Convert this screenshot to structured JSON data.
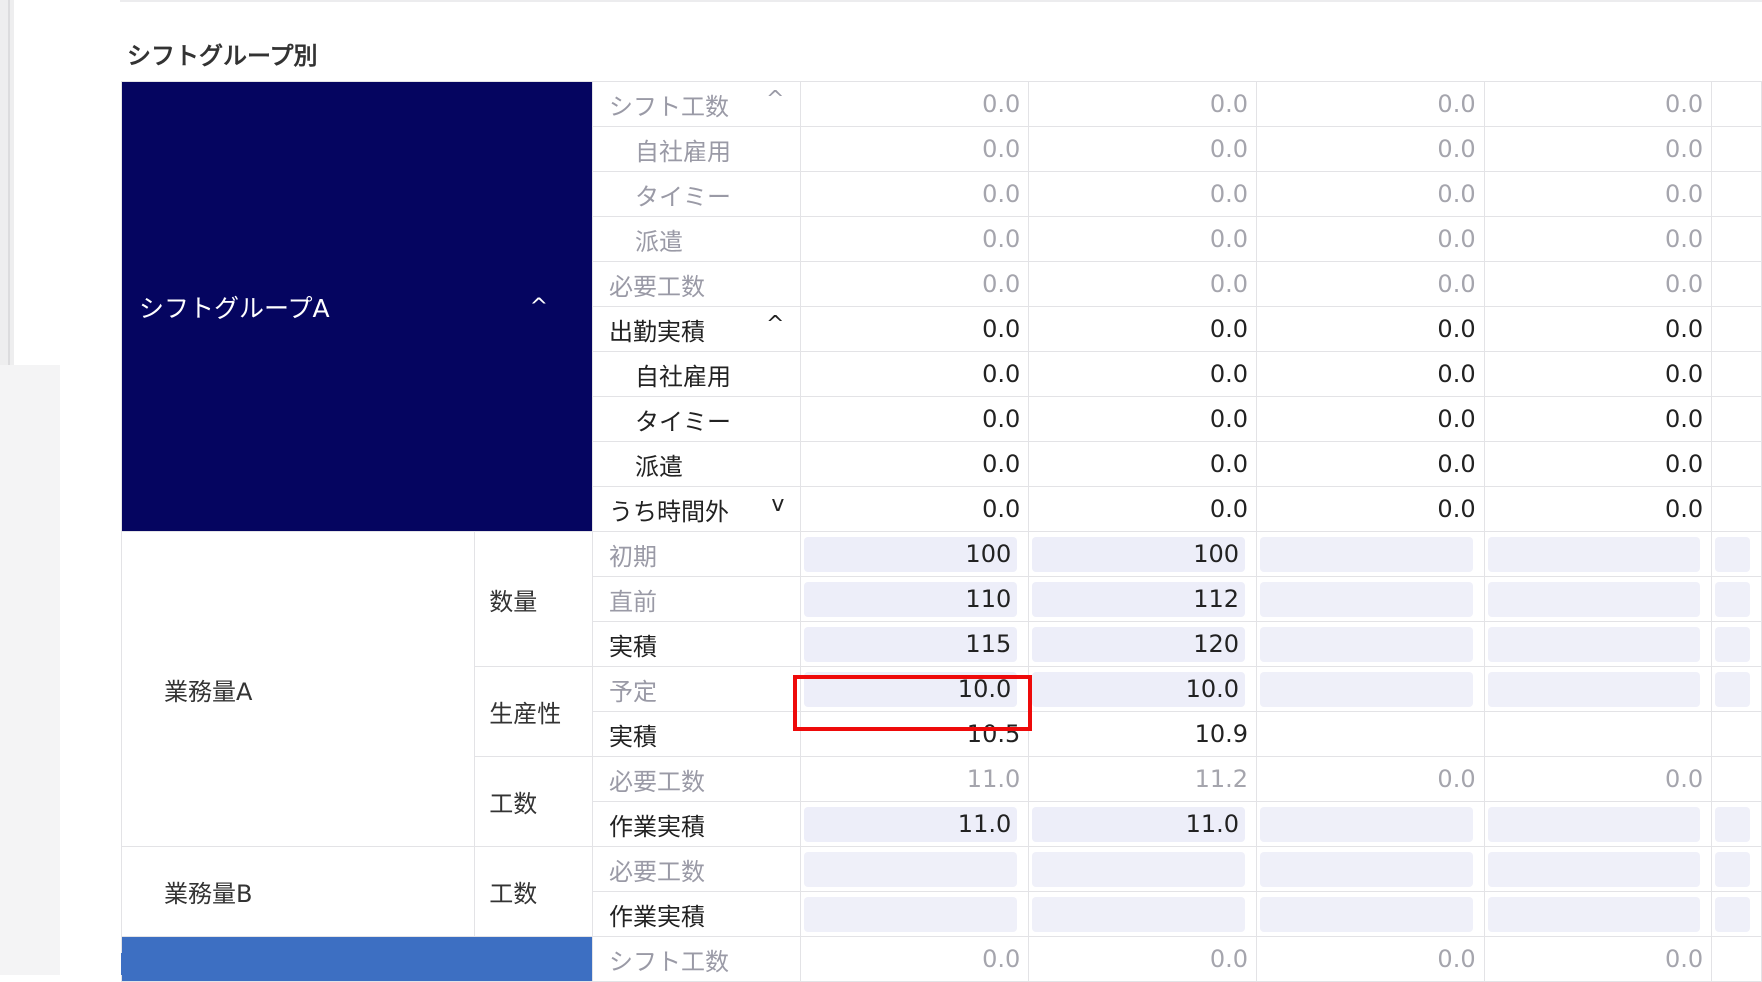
{
  "section": {
    "title": "シフトグループ別"
  },
  "group_a": {
    "name": "シフトグループA",
    "chevron": "^"
  },
  "rows": [
    {
      "label": "シフト工数",
      "chev": "^",
      "style": "gray",
      "indent": false,
      "values": [
        "0.0",
        "0.0",
        "0.0",
        "0.0"
      ]
    },
    {
      "label": "自社雇用",
      "chev": "",
      "style": "gray",
      "indent": true,
      "values": [
        "0.0",
        "0.0",
        "0.0",
        "0.0"
      ]
    },
    {
      "label": "タイミー",
      "chev": "",
      "style": "gray",
      "indent": true,
      "values": [
        "0.0",
        "0.0",
        "0.0",
        "0.0"
      ]
    },
    {
      "label": "派遣",
      "chev": "",
      "style": "gray",
      "indent": true,
      "values": [
        "0.0",
        "0.0",
        "0.0",
        "0.0"
      ]
    },
    {
      "label": "必要工数",
      "chev": "",
      "style": "gray",
      "indent": false,
      "values": [
        "0.0",
        "0.0",
        "0.0",
        "0.0"
      ]
    },
    {
      "label": "出勤実積",
      "chev": "^",
      "style": "dark",
      "indent": false,
      "values": [
        "0.0",
        "0.0",
        "0.0",
        "0.0"
      ]
    },
    {
      "label": "自社雇用",
      "chev": "",
      "style": "dark",
      "indent": true,
      "values": [
        "0.0",
        "0.0",
        "0.0",
        "0.0"
      ]
    },
    {
      "label": "タイミー",
      "chev": "",
      "style": "dark",
      "indent": true,
      "values": [
        "0.0",
        "0.0",
        "0.0",
        "0.0"
      ]
    },
    {
      "label": "派遣",
      "chev": "",
      "style": "dark",
      "indent": true,
      "values": [
        "0.0",
        "0.0",
        "0.0",
        "0.0"
      ]
    },
    {
      "label": "うち時間外",
      "chev": "v",
      "style": "dark",
      "indent": false,
      "values": [
        "0.0",
        "0.0",
        "0.0",
        "0.0"
      ]
    }
  ],
  "work_a": {
    "name": "業務量A",
    "qty_label": "数量",
    "prod_label": "生産性",
    "manhour_label": "工数",
    "rows": {
      "initial": {
        "label": "初期",
        "values": [
          "100",
          "100",
          "",
          ""
        ]
      },
      "prev": {
        "label": "直前",
        "values": [
          "110",
          "112",
          "",
          ""
        ]
      },
      "actual_qty": {
        "label": "実積",
        "values": [
          "115",
          "120",
          "",
          ""
        ]
      },
      "plan": {
        "label": "予定",
        "values": [
          "10.0",
          "10.0",
          "",
          ""
        ]
      },
      "actual_prod": {
        "label": "実積",
        "values": [
          "10.5",
          "10.9",
          "",
          ""
        ]
      },
      "required": {
        "label": "必要工数",
        "values": [
          "11.0",
          "11.2",
          "0.0",
          "0.0"
        ]
      },
      "work_actual": {
        "label": "作業実積",
        "values": [
          "11.0",
          "11.0",
          "",
          ""
        ]
      }
    }
  },
  "work_b": {
    "name": "業務量B",
    "manhour_label": "工数",
    "rows": {
      "required": {
        "label": "必要工数"
      },
      "work_actual": {
        "label": "作業実積"
      }
    }
  },
  "next_group": {
    "row_label": "シフト工数",
    "values": [
      "0.0",
      "0.0",
      "0.0",
      "0.0"
    ]
  }
}
